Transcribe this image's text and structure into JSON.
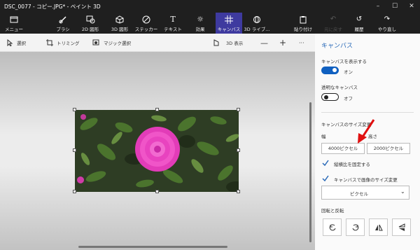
{
  "window": {
    "title": "DSC_0077 - コピー.JPG* - ペイント 3D"
  },
  "ribbon": {
    "menu": "メニュー",
    "brush": "ブラシ",
    "shapes2d": "2D 図形",
    "shapes3d": "3D 図形",
    "stickers": "ステッカー",
    "text": "テキスト",
    "effects": "効果",
    "canvas": "キャンバス",
    "library3d": "3D ライブ...",
    "paste": "貼り付け",
    "undo": "元に戻す",
    "history": "履歴",
    "redo": "やり直し"
  },
  "toolbar": {
    "select": "選択",
    "crop": "トリミング",
    "magic_select": "マジック選択",
    "view3d": "3D 表示",
    "more": "···"
  },
  "panel": {
    "title": "キャンバス",
    "show_canvas_label": "キャンバスを表示する",
    "show_canvas_state": "オン",
    "transparent_label": "透明なキャンバス",
    "transparent_state": "オフ",
    "resize_title": "キャンバスのサイズ変更",
    "width_label": "幅",
    "height_label": "高さ",
    "width_value": "4000ピクセル",
    "height_value": "2000ピクセル",
    "lock_aspect": "縦横比を固定する",
    "resize_image": "キャンバスで画像のサイズ変更",
    "unit": "ピクセル",
    "rotate_flip": "回転と反転"
  },
  "colors": {
    "accent": "#3e3a9f",
    "toggle_on": "#1060c0",
    "panel_heading": "#2a6ab8",
    "arrow": "#e01010"
  }
}
